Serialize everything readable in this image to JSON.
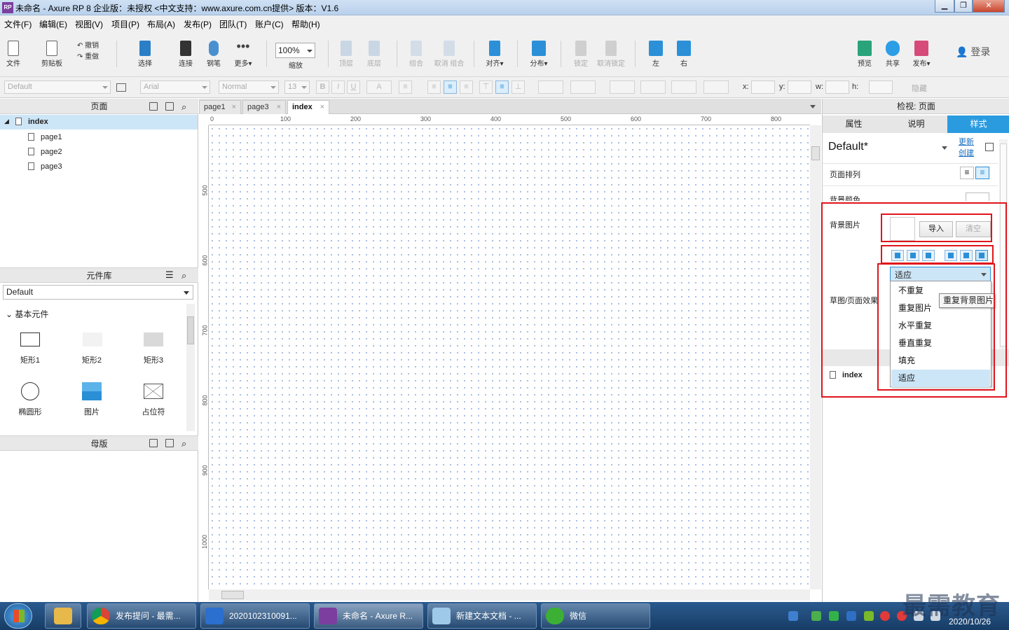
{
  "window": {
    "title": "未命名 - Axure RP 8 企业版：未授权      <中文支持：www.axure.com.cn提供> 版本：V1.6",
    "logo": "RP"
  },
  "menu": [
    "文件(F)",
    "编辑(E)",
    "视图(V)",
    "项目(P)",
    "布局(A)",
    "发布(P)",
    "团队(T)",
    "账户(C)",
    "帮助(H)"
  ],
  "toolbar": {
    "file": "文件",
    "clipboard": "剪贴板",
    "undo": "撤销",
    "redo": "重做",
    "select": "选择",
    "connect": "连接",
    "pen": "钢笔",
    "more": "更多▾",
    "zoom_value": "100%",
    "zoom_label": "缩放",
    "top": "顶层",
    "bottom": "底层",
    "group": "组合",
    "ungroup": "取消 组合",
    "align": "对齐▾",
    "distribute": "分布▾",
    "lock": "锁定",
    "unlock": "取消锁定",
    "left": "左",
    "right": "右",
    "preview": "预览",
    "share": "共享",
    "publish": "发布▾",
    "login": "登录"
  },
  "format": {
    "style": "Default",
    "font": "Arial",
    "weight": "Normal",
    "size": "13",
    "x_label": "x:",
    "y_label": "y:",
    "w_label": "w:",
    "h_label": "h:",
    "hide_label": "隐藏",
    "bold": "B",
    "italic": "I",
    "underline": "U",
    "text_color": "A"
  },
  "pages_panel": {
    "title": "页面",
    "root": "index",
    "children": [
      "page1",
      "page2",
      "page3"
    ]
  },
  "library_panel": {
    "title": "元件库",
    "selected": "Default",
    "section": "基本元件",
    "widgets": [
      "矩形1",
      "矩形2",
      "矩形3",
      "椭圆形",
      "图片",
      "占位符"
    ]
  },
  "masters_panel": {
    "title": "母版"
  },
  "tabs": [
    "page1",
    "page3",
    "index"
  ],
  "ruler_h": [
    "0",
    "100",
    "200",
    "300",
    "400",
    "500",
    "600",
    "700",
    "800"
  ],
  "ruler_v": [
    "500",
    "600",
    "700",
    "800",
    "900",
    "1000"
  ],
  "inspector": {
    "title": "检视: 页面",
    "tabs": [
      "属性",
      "说明",
      "样式"
    ],
    "style_name": "Default*",
    "update": "更新",
    "create": "创建",
    "page_align": "页面排列",
    "bg_color": "背景颜色",
    "bg_image": "背景图片",
    "import": "导入",
    "clear": "清空",
    "sketch": "草图/页面效果",
    "repeat_selected": "适应",
    "repeat_options": [
      "不重复",
      "重复图片",
      "水平重复",
      "垂直重复",
      "填充",
      "适应"
    ],
    "tooltip": "重复背景图片",
    "outline_item": "index"
  },
  "taskbar": {
    "items": [
      "发布提问 - 最需...",
      "2020102310091...",
      "未命名 - Axure R...",
      "新建文本文档 - ...",
      "微信"
    ],
    "date": "2020/10/26",
    "watermark": "最需教育"
  },
  "colors": {
    "accent": "#2b9be0",
    "highlight": "#e0141b",
    "taskbar": "#1f4a7a"
  }
}
